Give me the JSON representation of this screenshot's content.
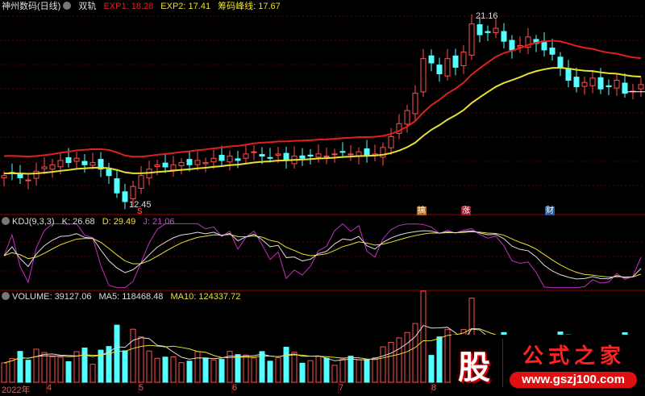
{
  "header": {
    "stock": "神州数码(日线)",
    "indicator": "双轨",
    "exp1": "EXP1: 18.28",
    "exp2": "EXP2: 17.41",
    "chip": "筹码峰线: 17.67"
  },
  "kdj": {
    "name": "KDJ(9,3,3)",
    "k": "K: 26.68",
    "d": "D: 29.49",
    "j": "J: 21.06"
  },
  "volume": {
    "name": "VOLUME: 39127.06",
    "ma5": "MA5: 118468.48",
    "ma10": "MA10: 124337.72"
  },
  "price_labels": {
    "high": "21.16",
    "low": "12.45",
    "signal": "S"
  },
  "tags": [
    "擒",
    "涨",
    "财"
  ],
  "xaxis": [
    "2022年",
    "4",
    "5",
    "6",
    "7",
    "8"
  ],
  "logo": {
    "char": "股",
    "name": "公式之家",
    "url": "www.gszj100.com"
  },
  "colors": {
    "up": "#ff5050",
    "down": "#54ffff",
    "exp1": "#e02020",
    "exp2": "#e8e030",
    "grid": "#5a0000"
  },
  "closes": [
    13.8,
    13.9,
    13.7,
    13.6,
    14.0,
    14.2,
    14.3,
    14.5,
    14.4,
    14.6,
    14.3,
    14.4,
    14.1,
    13.8,
    13.0,
    12.6,
    13.3,
    13.8,
    14.1,
    14.3,
    14.2,
    14.3,
    14.4,
    14.3,
    14.5,
    14.4,
    14.6,
    14.5,
    14.7,
    14.5,
    14.8,
    14.9,
    14.7,
    14.6,
    14.8,
    14.5,
    14.7,
    14.6,
    14.7,
    14.8,
    14.7,
    14.8,
    14.9,
    14.8,
    14.9,
    14.7,
    14.8,
    15.1,
    15.6,
    16.2,
    16.8,
    17.6,
    19.2,
    19.0,
    18.5,
    19.2,
    18.8,
    19.5,
    20.8,
    20.3,
    20.4,
    20.6,
    20.0,
    19.6,
    19.8,
    20.2,
    19.9,
    19.6,
    19.4,
    18.8,
    18.2,
    17.9,
    18.1,
    18.3,
    17.8,
    17.9,
    18.2,
    17.6,
    17.7,
    18.0
  ]
}
